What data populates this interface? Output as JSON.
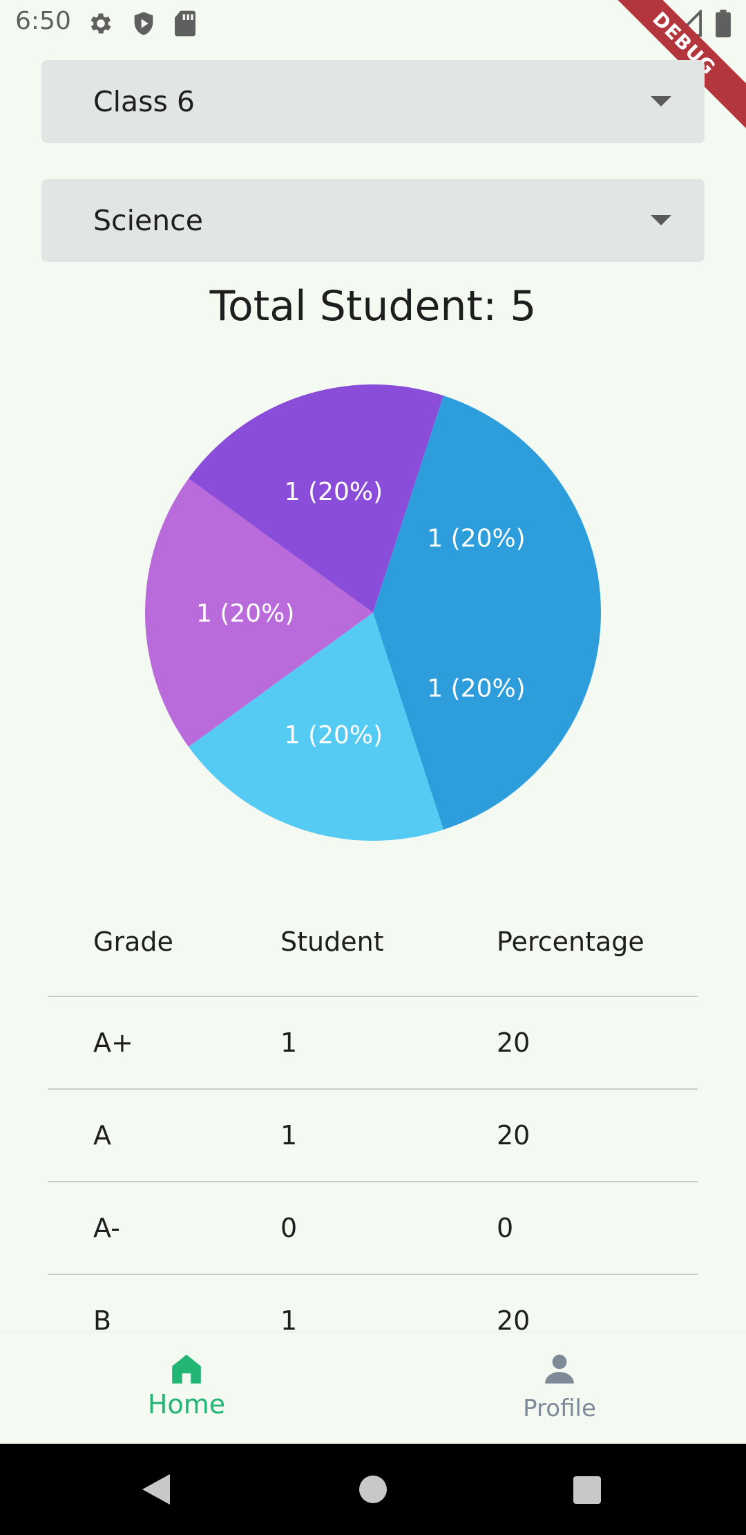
{
  "status_bar": {
    "time": "6:50",
    "debug_label": "DEBUG",
    "icons": [
      "settings-icon",
      "shield-icon",
      "sd-card-icon",
      "wifi-icon",
      "signal-icon",
      "battery-icon"
    ]
  },
  "filters": {
    "class_value": "Class 6",
    "subject_value": "Science"
  },
  "summary": {
    "total_label": "Total Student: 5"
  },
  "chart_data": {
    "type": "pie",
    "slices": [
      {
        "label": "1 (20%)",
        "value": 1,
        "percent": 20,
        "color": "#2e9ddc"
      },
      {
        "label": "1 (20%)",
        "value": 1,
        "percent": 20,
        "color": "#55caf2"
      },
      {
        "label": "1 (20%)",
        "value": 1,
        "percent": 20,
        "color": "#b96adb"
      },
      {
        "label": "1 (20%)",
        "value": 1,
        "percent": 20,
        "color": "#8a4dd9"
      },
      {
        "label": "1 (20%)",
        "value": 1,
        "percent": 20,
        "color": "#2e9ddc"
      }
    ]
  },
  "table": {
    "headers": [
      "Grade",
      "Student",
      "Percentage"
    ],
    "rows": [
      [
        "A+",
        "1",
        "20"
      ],
      [
        "A",
        "1",
        "20"
      ],
      [
        "A-",
        "0",
        "0"
      ],
      [
        "B",
        "1",
        "20"
      ]
    ]
  },
  "bottom_nav": {
    "items": [
      {
        "label": "Home",
        "icon": "home-icon",
        "active": true
      },
      {
        "label": "Profile",
        "icon": "person-icon",
        "active": false
      }
    ],
    "active_color": "#22b573",
    "inactive_color": "#7f8a99"
  },
  "system_nav": {
    "icons": [
      "back-icon",
      "home-circle-icon",
      "recents-icon"
    ]
  }
}
